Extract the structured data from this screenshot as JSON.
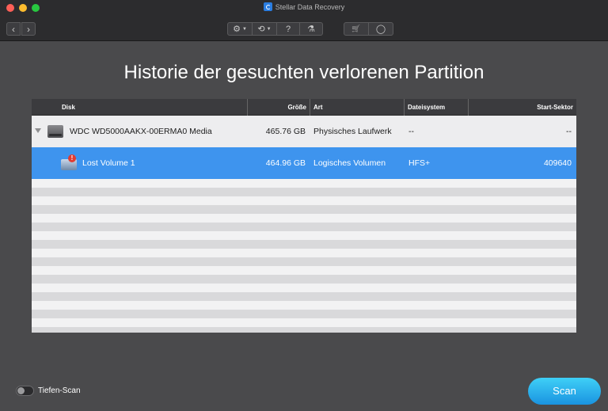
{
  "window": {
    "title": "Stellar Data Recovery"
  },
  "toolbar": {
    "back_glyph": "‹",
    "forward_glyph": "›",
    "settings_glyph": "⚙",
    "history_glyph": "⟲",
    "help_glyph": "?",
    "scan_glyph": "⚗",
    "cart_glyph": "🛒",
    "account_glyph": "◯",
    "caret_glyph": "▼"
  },
  "page": {
    "heading": "Historie der gesuchten verlorenen Partition"
  },
  "table": {
    "columns": {
      "disk": "Disk",
      "size": "Größe",
      "type": "Art",
      "filesystem": "Dateisystem",
      "start_sector": "Start-Sektor"
    },
    "disk_row": {
      "name": "WDC WD5000AAKX-00ERMA0 Media",
      "size": "465.76 GB",
      "type": "Physisches Laufwerk",
      "filesystem": "--",
      "start_sector": "--"
    },
    "volume_row": {
      "name": "Lost Volume 1",
      "size": "464.96 GB",
      "type": "Logisches Volumen",
      "filesystem": "HFS+",
      "start_sector": "409640",
      "warning_glyph": "!"
    }
  },
  "footer": {
    "deep_scan_label": "Tiefen-Scan",
    "deep_scan_enabled": false,
    "scan_button": "Scan"
  },
  "colors": {
    "selection": "#3e94ee",
    "scan_button": "#1a93e0",
    "background": "#4a4a4c"
  }
}
